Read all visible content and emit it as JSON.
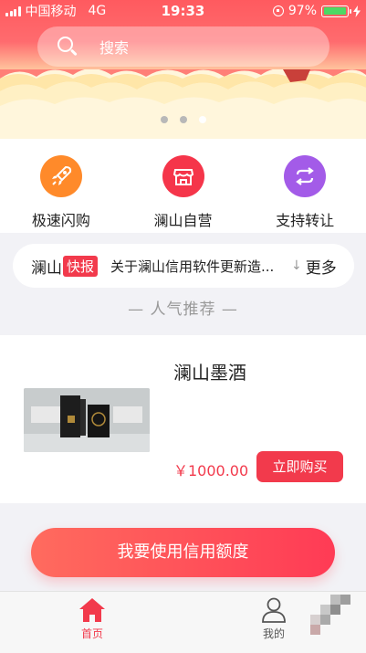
{
  "status_bar": {
    "carrier": "中国移动",
    "network": "4G",
    "time": "19:33",
    "battery_percent": "97%"
  },
  "search": {
    "placeholder": "搜索"
  },
  "banner": {
    "page_count": 3,
    "active_index": 2
  },
  "features": [
    {
      "label": "极速闪购",
      "icon": "rocket-icon",
      "color": "#ff8a2a"
    },
    {
      "label": "澜山自营",
      "icon": "store-icon",
      "color": "#f5354a"
    },
    {
      "label": "支持转让",
      "icon": "transfer-icon",
      "color": "#a35be8"
    }
  ],
  "ticker": {
    "brand": "澜山",
    "badge": "快报",
    "text": "关于澜山信用软件更新造...",
    "more": "更多"
  },
  "section": {
    "title": "— 人气推荐 —"
  },
  "product": {
    "name": "澜山墨酒",
    "price": "￥1000.00",
    "buy_label": "立即购买"
  },
  "credit_button": {
    "label": "我要使用信用额度"
  },
  "tabbar": {
    "home_label": "首页",
    "mine_label": "我的"
  },
  "colors": {
    "accent": "#f23a4c",
    "header_gradient_top": "#ff5a5f"
  }
}
